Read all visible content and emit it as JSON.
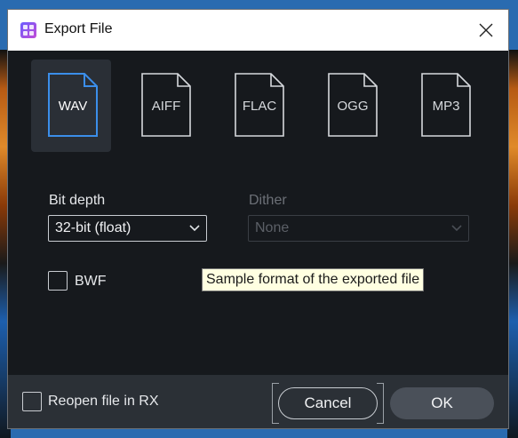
{
  "window": {
    "title": "Export File",
    "app_icon": "rx-app-icon",
    "close_icon": "close-icon"
  },
  "formats": {
    "selected": "WAV",
    "items": [
      {
        "label": "WAV"
      },
      {
        "label": "AIFF"
      },
      {
        "label": "FLAC"
      },
      {
        "label": "OGG"
      },
      {
        "label": "MP3"
      }
    ]
  },
  "bit_depth": {
    "label": "Bit depth",
    "value": "32-bit (float)"
  },
  "dither": {
    "label": "Dither",
    "value": "None",
    "enabled": false
  },
  "bwf": {
    "label": "BWF",
    "checked": false
  },
  "tooltip": {
    "text": "Sample format of the exported file"
  },
  "footer": {
    "reopen_label": "Reopen file in RX",
    "reopen_checked": false,
    "cancel_label": "Cancel",
    "ok_label": "OK"
  },
  "colors": {
    "dialog_bg": "#16191d",
    "footer_bg": "#2b3036",
    "selected_accent": "#3b8eea",
    "tooltip_bg": "#ffffe1"
  }
}
